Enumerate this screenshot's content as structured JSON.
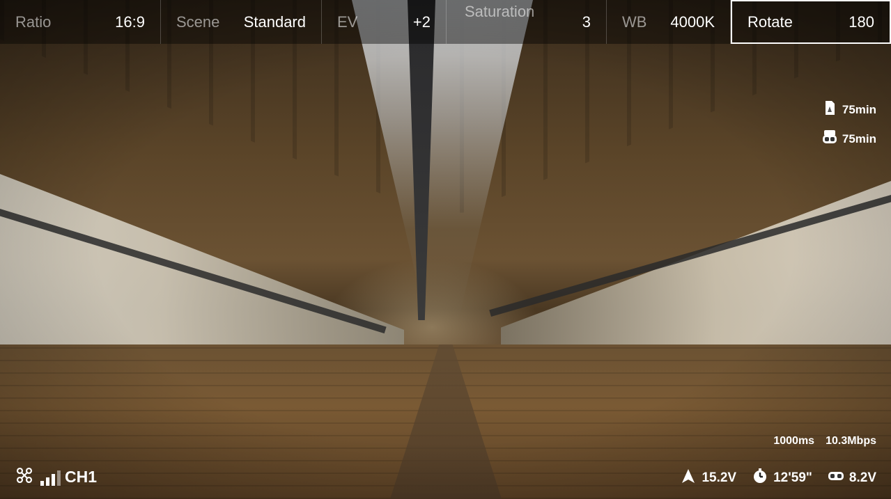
{
  "settings": [
    {
      "label": "Ratio",
      "value": "16:9"
    },
    {
      "label": "Scene",
      "value": "Standard"
    },
    {
      "label": "EV",
      "value": "+2"
    },
    {
      "label": "Saturation",
      "value": "3"
    },
    {
      "label": "WB",
      "value": "4000K"
    },
    {
      "label": "Rotate",
      "value": "180",
      "selected": true
    }
  ],
  "indicators": {
    "sd_time": "75min",
    "goggles_time": "75min"
  },
  "link": {
    "latency": "1000ms",
    "bitrate": "10.3Mbps"
  },
  "status": {
    "channel": "CH1",
    "aircraft_voltage": "15.2V",
    "flight_time": "12'59\"",
    "goggles_voltage": "8.2V"
  },
  "icons": [
    "drone-icon",
    "signal-bars-icon",
    "sd-card-icon",
    "goggles-icon",
    "aircraft-arrow-icon",
    "timer-icon",
    "goggles-battery-icon"
  ],
  "colors": {
    "overlay": "#000000",
    "text": "#ffffff"
  }
}
